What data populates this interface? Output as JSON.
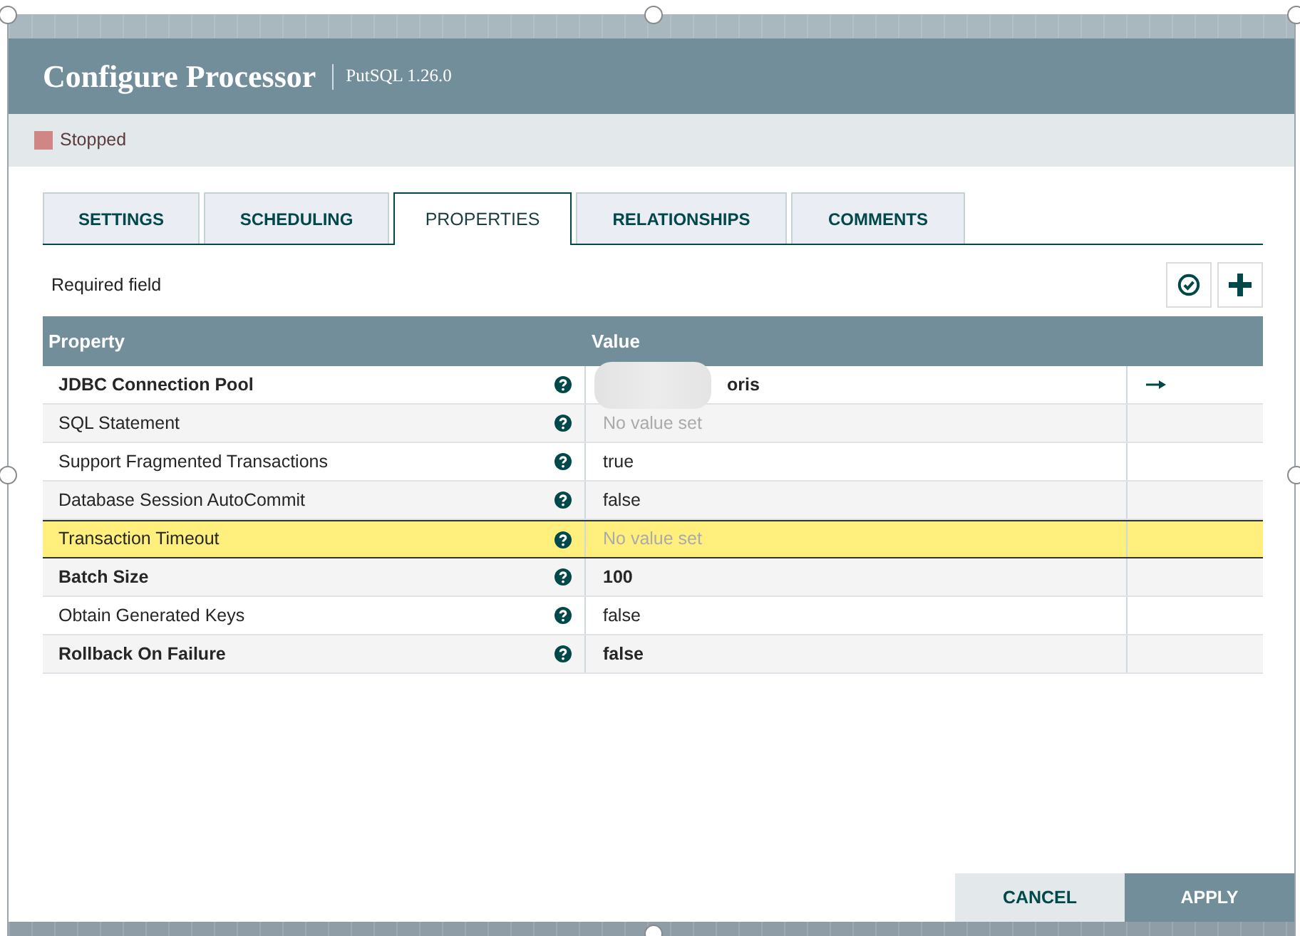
{
  "window": {
    "title": "Configure Processor",
    "subtitle": "PutSQL 1.26.0"
  },
  "status": {
    "label": "Stopped"
  },
  "tabs": [
    {
      "label": "SETTINGS",
      "selected": false
    },
    {
      "label": "SCHEDULING",
      "selected": false
    },
    {
      "label": "PROPERTIES",
      "selected": true
    },
    {
      "label": "RELATIONSHIPS",
      "selected": false
    },
    {
      "label": "COMMENTS",
      "selected": false
    }
  ],
  "required_note": "Required field",
  "table": {
    "columns": [
      "Property",
      "Value"
    ],
    "rows": [
      {
        "property": "JDBC Connection Pool",
        "value": "oris",
        "required": true,
        "value_set": true,
        "redacted": true,
        "link": true,
        "selected": false
      },
      {
        "property": "SQL Statement",
        "value": "No value set",
        "required": false,
        "value_set": false,
        "redacted": false,
        "link": false,
        "selected": false
      },
      {
        "property": "Support Fragmented Transactions",
        "value": "true",
        "required": false,
        "value_set": true,
        "redacted": false,
        "link": false,
        "selected": false
      },
      {
        "property": "Database Session AutoCommit",
        "value": "false",
        "required": false,
        "value_set": true,
        "redacted": false,
        "link": false,
        "selected": false
      },
      {
        "property": "Transaction Timeout",
        "value": "No value set",
        "required": false,
        "value_set": false,
        "redacted": false,
        "link": false,
        "selected": true
      },
      {
        "property": "Batch Size",
        "value": "100",
        "required": true,
        "value_set": true,
        "redacted": false,
        "link": false,
        "selected": false
      },
      {
        "property": "Obtain Generated Keys",
        "value": "false",
        "required": false,
        "value_set": true,
        "redacted": false,
        "link": false,
        "selected": false
      },
      {
        "property": "Rollback On Failure",
        "value": "false",
        "required": true,
        "value_set": true,
        "redacted": false,
        "link": false,
        "selected": false
      }
    ]
  },
  "buttons": [
    {
      "label": "CANCEL",
      "kind": "secondary"
    },
    {
      "label": "APPLY",
      "kind": "primary"
    }
  ]
}
